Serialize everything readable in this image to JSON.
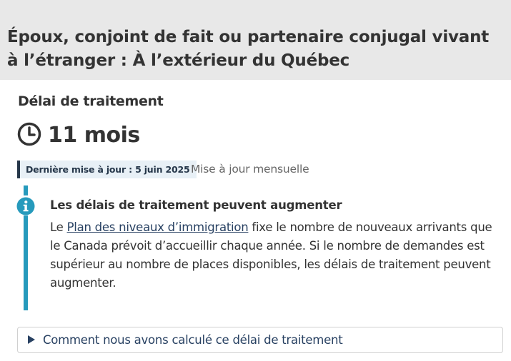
{
  "page": {
    "title": "Époux, conjoint de fait ou partenaire conjugal vivant à l’étranger : À l’extérieur du Québec"
  },
  "processing": {
    "heading": "Délai de traitement",
    "duration": "11 mois",
    "duration_icon": "clock-icon",
    "last_updated_label": "Dernière mise à jour : 5 juin 2025",
    "update_frequency": "Mise à jour mensuelle"
  },
  "alert": {
    "icon": "info-icon",
    "title": "Les délais de traitement peuvent augmenter",
    "body_prefix": "Le ",
    "link_text": "Plan des niveaux d’immigration",
    "body_suffix": " fixe le nombre de nouveaux arrivants que le Canada prévoit d’accueillir chaque année. Si le nombre de demandes est supérieur au nombre de places disponibles, les délais de traitement peuvent augmenter."
  },
  "details": {
    "summary": "Comment nous avons calculé ce délai de traitement"
  },
  "colors": {
    "header_background": "#e8e8e8",
    "alert_accent": "#269abc",
    "link": "#284162",
    "badge_background": "#e8f0f6",
    "badge_border": "#26374a"
  }
}
